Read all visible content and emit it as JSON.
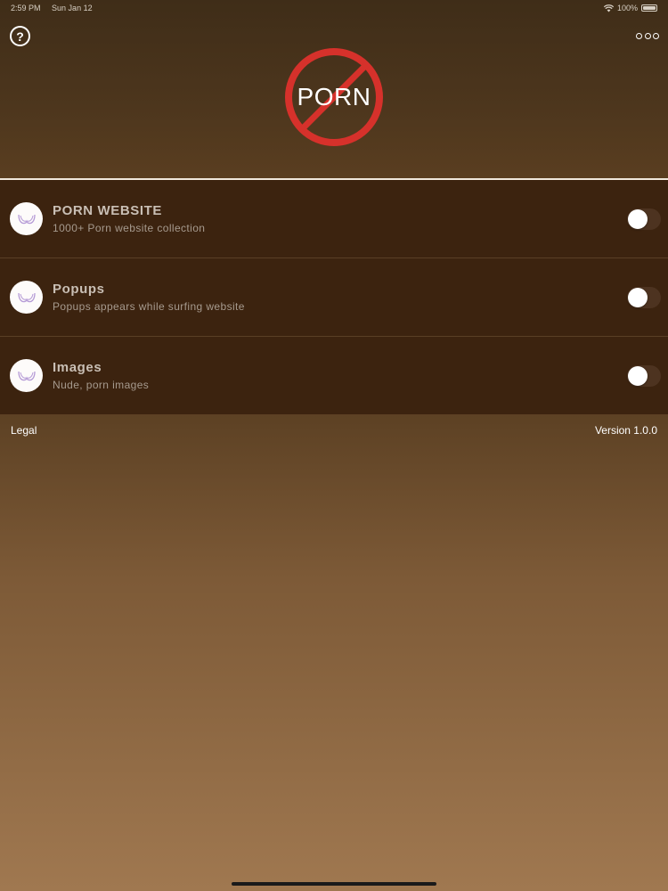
{
  "status_bar": {
    "time": "2:59 PM",
    "date": "Sun Jan 12",
    "battery": "100%"
  },
  "header": {
    "help_icon": "question-circle-icon",
    "help_label": "?",
    "more_icon": "more-horizontal-icon",
    "logo_text": "PORN",
    "logo_icon": "prohibited-sign-icon",
    "accent_color": "#d6312b"
  },
  "settings": [
    {
      "icon": "bra-icon",
      "title": "PORN WEBSITE",
      "subtitle": "1000+ Porn website collection",
      "enabled": false
    },
    {
      "icon": "bra-icon",
      "title": "Popups",
      "subtitle": "Popups appears while surfing website",
      "enabled": false
    },
    {
      "icon": "bra-icon",
      "title": "Images",
      "subtitle": "Nude, porn images",
      "enabled": false
    }
  ],
  "footer": {
    "legal_label": "Legal",
    "version_label": "Version 1.0.0"
  }
}
